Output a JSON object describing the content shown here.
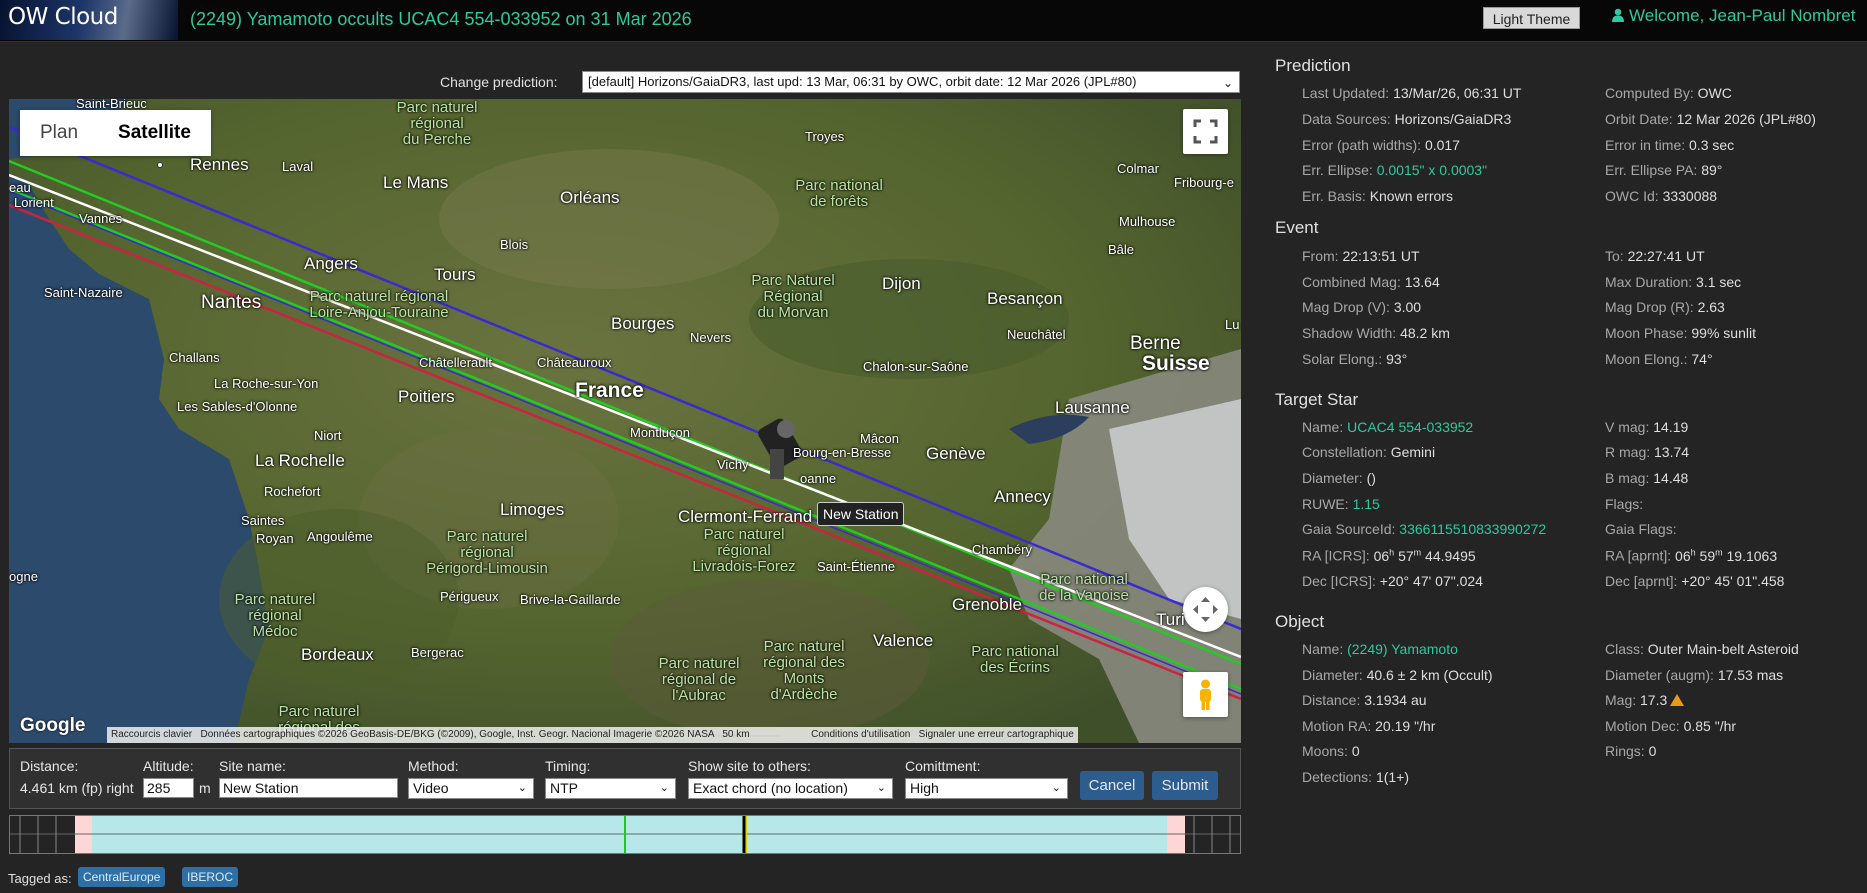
{
  "header": {
    "logo": "OW Cloud",
    "event_title": "(2249) Yamamoto occults UCAC4 554-033952 on 31 Mar 2026",
    "theme_button": "Light Theme",
    "welcome": "Welcome, Jean-Paul Nombret"
  },
  "prediction_select": {
    "label": "Change prediction:",
    "value": "[default] Horizons/GaiaDR3, last upd: 13 Mar, 06:31 by OWC, orbit date: 12 Mar 2026 (JPL#80)"
  },
  "map": {
    "tabs": [
      "Plan",
      "Satellite"
    ],
    "active_tab": "Satellite",
    "google": "Google",
    "attribution": [
      "Raccourcis clavier",
      "Données cartographiques ©2026 GeoBasis-DE/BKG (©2009), Google, Inst. Geogr. Nacional Imagerie ©2026 NASA",
      "50 km",
      "Conditions d'utilisation",
      "Signaler une erreur cartographique"
    ],
    "tooltip": "New Station",
    "places": {
      "saint_brieuc": "Saint-Brieuc",
      "rennes": "Rennes",
      "laval": "Laval",
      "le_mans": "Le Mans",
      "orleans": "Orléans",
      "troyes": "Troyes",
      "colmar": "Colmar",
      "fribourg": "Fribourg-e",
      "mulhouse": "Mulhouse",
      "bale": "Bâle",
      "lorient": "Lorient",
      "vannes": "Vannes",
      "eau": "eau",
      "angers": "Angers",
      "blois": "Blois",
      "tours": "Tours",
      "dijon": "Dijon",
      "besancon": "Besançon",
      "saint_nazaire": "Saint-Nazaire",
      "nantes": "Nantes",
      "bourges": "Bourges",
      "nevers": "Nevers",
      "neuchatel": "Neuchâtel",
      "berne": "Berne",
      "suisse": "Suisse",
      "lu": "Lu",
      "challans": "Challans",
      "chatellerault": "Châtellerault",
      "chateauroux": "Châteauroux",
      "france": "France",
      "chalon": "Chalon-sur-Saône",
      "la_roche": "La Roche-sur-Yon",
      "poitiers": "Poitiers",
      "lausanne": "Lausanne",
      "les_sables": "Les Sables-d'Olonne",
      "montlucon": "Montluçon",
      "macon": "Mâcon",
      "niort": "Niort",
      "bourg": "Bourg-en-Bresse",
      "geneve": "Genève",
      "la_rochelle": "La Rochelle",
      "vichy": "Vichy",
      "roanne": "oanne",
      "rochefort": "Rochefort",
      "annecy": "Annecy",
      "limoges": "Limoges",
      "clermont": "Clermont-Ferrand",
      "saintes": "Saintes",
      "royan": "Royan",
      "angouleme": "Angoulême",
      "chambery": "Chambéry",
      "saint_etienne": "Saint-Étienne",
      "ogne": "ogne",
      "perigueux": "Périgueux",
      "brive": "Brive-la-Gaillarde",
      "grenoble": "Grenoble",
      "turin": "Turi",
      "bordeaux": "Bordeaux",
      "bergerac": "Bergerac",
      "valence": "Valence"
    },
    "parks": {
      "perche": "Parc naturel\nrégional\ndu Perche",
      "forets": "Parc national\nde forêts",
      "loire": "Parc naturel régional\nLoire-Anjou-Touraine",
      "morvan": "Parc Naturel\nRégional\ndu Morvan",
      "perigord": "Parc naturel\nrégional\nPérigord-Limousin",
      "livradois": "Parc naturel\nrégional\nLivradois-Forez",
      "vanoise": "Parc national\nde la Vanoise",
      "medoc": "Parc naturel\nrégional\nMédoc",
      "aubrac": "Parc naturel\nrégional de\nl'Aubrac",
      "ardeche": "Parc naturel\nrégional des\nMonts\nd'Ardèche",
      "ecrins": "Parc national\ndes Écrins",
      "landes": "Parc naturel\nrégional des"
    }
  },
  "station_form": {
    "distance_label": "Distance:",
    "distance_value": "4.461 km (fp) right",
    "altitude_label": "Altitude:",
    "altitude_value": "285",
    "altitude_unit": "m",
    "site_name_label": "Site name:",
    "site_name_value": "New Station",
    "method_label": "Method:",
    "method_value": "Video",
    "timing_label": "Timing:",
    "timing_value": "NTP",
    "show_site_label": "Show site to others:",
    "show_site_value": "Exact chord (no location)",
    "commitment_label": "Comittment:",
    "commitment_value": "High",
    "cancel": "Cancel",
    "submit": "Submit"
  },
  "tags": {
    "label": "Tagged as:",
    "items": [
      "CentralEurope",
      "IBEROC"
    ]
  },
  "prediction": {
    "title": "Prediction",
    "last_updated_k": "Last Updated:",
    "last_updated_v": "13/Mar/26, 06:31 UT",
    "computed_by_k": "Computed By:",
    "computed_by_v": "OWC",
    "data_sources_k": "Data Sources:",
    "data_sources_v": "Horizons/GaiaDR3",
    "orbit_date_k": "Orbit Date:",
    "orbit_date_v": "12 Mar 2026 (JPL#80)",
    "error_path_k": "Error (path widths):",
    "error_path_v": "0.017",
    "error_time_k": "Error in time:",
    "error_time_v": "0.3 sec",
    "err_ellipse_k": "Err. Ellipse:",
    "err_ellipse_v": "0.0015\" x 0.0003\"",
    "err_ellipse_pa_k": "Err. Ellipse PA:",
    "err_ellipse_pa_v": "89°",
    "err_basis_k": "Err. Basis:",
    "err_basis_v": "Known errors",
    "owc_id_k": "OWC Id:",
    "owc_id_v": "3330088"
  },
  "event": {
    "title": "Event",
    "from_k": "From:",
    "from_v": "22:13:51 UT",
    "to_k": "To:",
    "to_v": "22:27:41 UT",
    "combined_mag_k": "Combined Mag:",
    "combined_mag_v": "13.64",
    "max_duration_k": "Max Duration:",
    "max_duration_v": "3.1 sec",
    "mag_drop_v_k": "Mag Drop (V):",
    "mag_drop_v_v": "3.00",
    "mag_drop_r_k": "Mag Drop (R):",
    "mag_drop_r_v": "2.63",
    "shadow_width_k": "Shadow Width:",
    "shadow_width_v": "48.2 km",
    "moon_phase_k": "Moon Phase:",
    "moon_phase_v": "99% sunlit",
    "solar_elong_k": "Solar Elong.:",
    "solar_elong_v": "93°",
    "moon_elong_k": "Moon Elong.:",
    "moon_elong_v": "74°"
  },
  "target_star": {
    "title": "Target Star",
    "name_k": "Name:",
    "name_v": "UCAC4 554-033952",
    "vmag_k": "V mag:",
    "vmag_v": "14.19",
    "constellation_k": "Constellation:",
    "constellation_v": "Gemini",
    "rmag_k": "R mag:",
    "rmag_v": "13.74",
    "diameter_k": "Diameter:",
    "diameter_v": " ()",
    "bmag_k": "B mag:",
    "bmag_v": "14.48",
    "ruwe_k": "RUWE:",
    "ruwe_v": "1.15",
    "flags_k": "Flags:",
    "gaia_source_k": "Gaia SourceId:",
    "gaia_source_v": "3366115510833990272",
    "gaia_flags_k": "Gaia Flags:",
    "ra_icrs_k": "RA [ICRS]:",
    "ra_icrs_h": "06",
    "ra_icrs_m": "57",
    "ra_icrs_s": "44.9495",
    "ra_aprnt_k": "RA [aprnt]:",
    "ra_aprnt_h": "06",
    "ra_aprnt_m": "59",
    "ra_aprnt_s": "19.1063",
    "dec_icrs_k": "Dec [ICRS]:",
    "dec_icrs_v": "+20° 47' 07\".024",
    "dec_aprnt_k": "Dec [aprnt]:",
    "dec_aprnt_v": "+20° 45' 01\".458"
  },
  "object": {
    "title": "Object",
    "name_k": "Name:",
    "name_v": "(2249) Yamamoto",
    "class_k": "Class:",
    "class_v": "Outer Main-belt Asteroid",
    "diameter_k": "Diameter:",
    "diameter_v": "40.6 ± 2 km (Occult)",
    "diameter_augm_k": "Diameter (augm):",
    "diameter_augm_v": "17.53 mas",
    "distance_k": "Distance:",
    "distance_v": "3.1934 au",
    "mag_k": "Mag:",
    "mag_v": "17.3",
    "motion_ra_k": "Motion RA:",
    "motion_ra_v": "20.19 \"/hr",
    "motion_dec_k": "Motion Dec:",
    "motion_dec_v": "0.85 \"/hr",
    "moons_k": "Moons:",
    "moons_v": "0",
    "rings_k": "Rings:",
    "rings_v": "0",
    "detections_k": "Detections:",
    "detections_v": "1(1+)"
  },
  "colors": {
    "accent": "#2ec99e",
    "button": "#2d5d8f",
    "path_center": "#ffffff",
    "path_shadow": "#22cc22",
    "path_error_north": "#3322cc",
    "path_error_south": "#cc2244"
  }
}
